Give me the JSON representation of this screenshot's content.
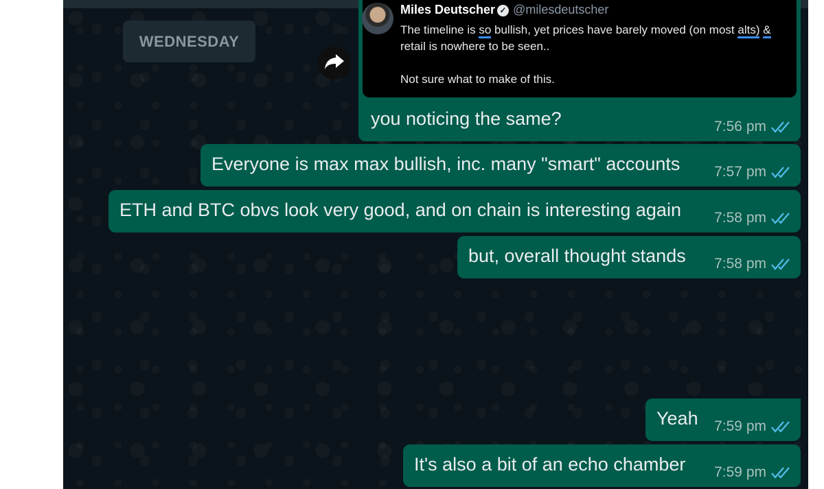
{
  "day_separator": "WEDNESDAY",
  "forward_icon": "forward-arrow-icon",
  "tweet": {
    "author": "Miles Deutscher",
    "handle": "@milesdeutscher",
    "line1_pre": "The timeline is ",
    "line1_so": "so",
    "line1_mid": " bullish, yet prices have barely moved (on most ",
    "line1_alts": "alts)",
    "line1_amp": "&",
    "line2": "retail is nowhere to be seen..",
    "line3": "Not sure what to make of this."
  },
  "messages": [
    {
      "text": "you noticing the same?",
      "time": "7:56 pm",
      "status": "read"
    },
    {
      "text": "Everyone is max max bullish, inc. many \"smart\" accounts",
      "time": "7:57 pm",
      "status": "read"
    },
    {
      "text": "ETH and BTC obvs look very good, and on chain is interesting again",
      "time": "7:58 pm",
      "status": "read"
    },
    {
      "text": "but, overall thought stands",
      "time": "7:58 pm",
      "status": "read"
    },
    {
      "text": "Yeah",
      "time": "7:59 pm",
      "status": "read"
    },
    {
      "text": "It's also a bit of an echo chamber",
      "time": "7:59 pm",
      "status": "read"
    }
  ],
  "colors": {
    "chat_bg": "#0b141a",
    "outgoing_bubble": "#005c4b",
    "read_ticks": "#53bdeb"
  }
}
